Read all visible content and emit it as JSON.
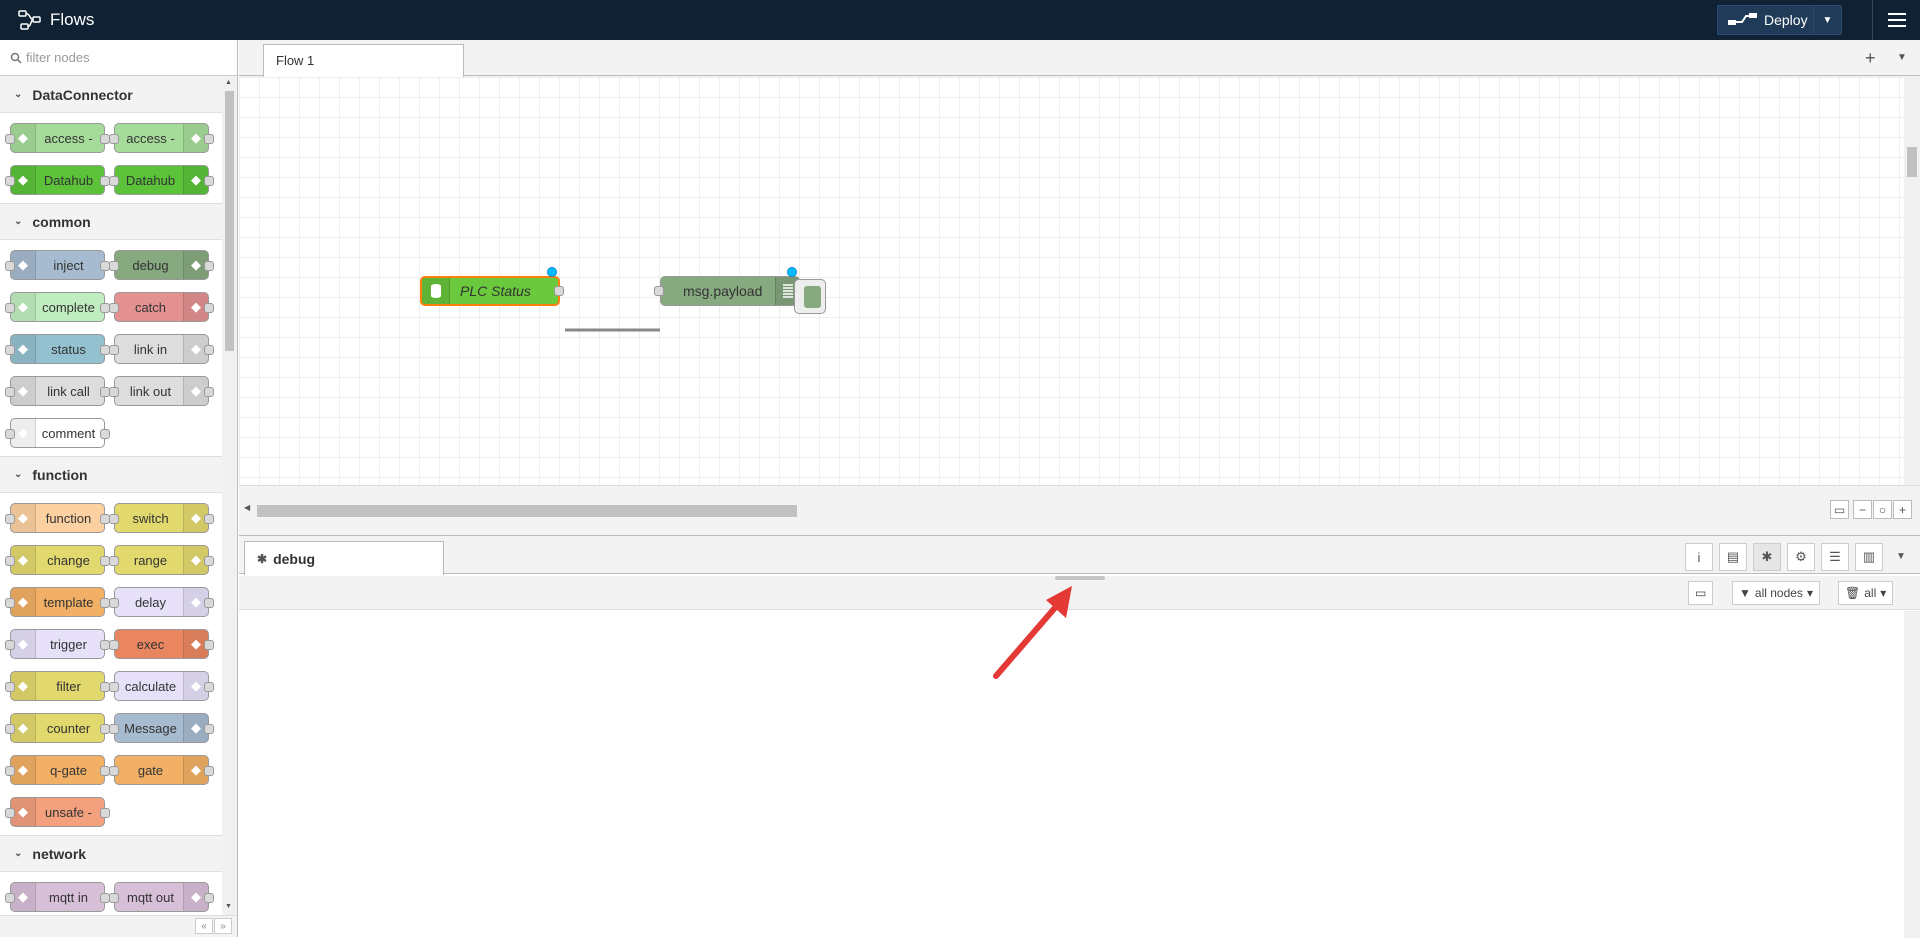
{
  "header": {
    "title": "Flows",
    "deploy_label": "Deploy"
  },
  "palette": {
    "search_placeholder": "filter nodes",
    "categories": [
      {
        "name": "DataConnector",
        "rows": [
          [
            {
              "label": "access -",
              "color": "#a6dc9a",
              "icon": "arrow-in"
            },
            {
              "label": "access -",
              "color": "#a6dc9a",
              "icon": "arrow-out"
            }
          ],
          [
            {
              "label": "Datahub",
              "color": "#5bc23a",
              "icon": "database"
            },
            {
              "label": "Datahub",
              "color": "#5bc23a",
              "icon": "database"
            }
          ]
        ]
      },
      {
        "name": "common",
        "rows": [
          [
            {
              "label": "inject",
              "color": "#a6bbcf"
            },
            {
              "label": "debug",
              "color": "#87a980"
            }
          ],
          [
            {
              "label": "complete",
              "color": "#c0edc0"
            },
            {
              "label": "catch",
              "color": "#e49191"
            }
          ],
          [
            {
              "label": "status",
              "color": "#94c1d0"
            },
            {
              "label": "link in",
              "color": "#dddddd"
            }
          ],
          [
            {
              "label": "link call",
              "color": "#dddddd"
            },
            {
              "label": "link out",
              "color": "#dddddd"
            }
          ],
          [
            {
              "label": "comment",
              "color": "#ffffff"
            }
          ]
        ]
      },
      {
        "name": "function",
        "rows": [
          [
            {
              "label": "function",
              "color": "#fdd0a2"
            },
            {
              "label": "switch",
              "color": "#e2d96e"
            }
          ],
          [
            {
              "label": "change",
              "color": "#e2d96e"
            },
            {
              "label": "range",
              "color": "#e2d96e"
            }
          ],
          [
            {
              "label": "template",
              "color": "#f2b066"
            },
            {
              "label": "delay",
              "color": "#e6e0f8"
            }
          ],
          [
            {
              "label": "trigger",
              "color": "#e6e0f8"
            },
            {
              "label": "exec",
              "color": "#e98660"
            }
          ],
          [
            {
              "label": "filter",
              "color": "#e2d96e"
            },
            {
              "label": "calculate",
              "color": "#e6e0f8"
            }
          ],
          [
            {
              "label": "counter",
              "color": "#e2d96e"
            },
            {
              "label": "Message",
              "color": "#a6bbcf"
            }
          ],
          [
            {
              "label": "q-gate",
              "color": "#f2b066"
            },
            {
              "label": "gate",
              "color": "#f2b066"
            }
          ],
          [
            {
              "label": "unsafe -",
              "color": "#f2a07e"
            }
          ]
        ]
      },
      {
        "name": "network",
        "rows": [
          [
            {
              "label": "mqtt in",
              "color": "#d8bfd8"
            },
            {
              "label": "mqtt out",
              "color": "#d8bfd8"
            }
          ]
        ]
      }
    ]
  },
  "workspace": {
    "tab_label": "Flow 1",
    "nodes": {
      "plc_status_label": "PLC Status",
      "debug_label": "msg.payload"
    }
  },
  "sidebar": {
    "tab_label": "debug",
    "filter_label": "all nodes",
    "clear_label": "all"
  }
}
